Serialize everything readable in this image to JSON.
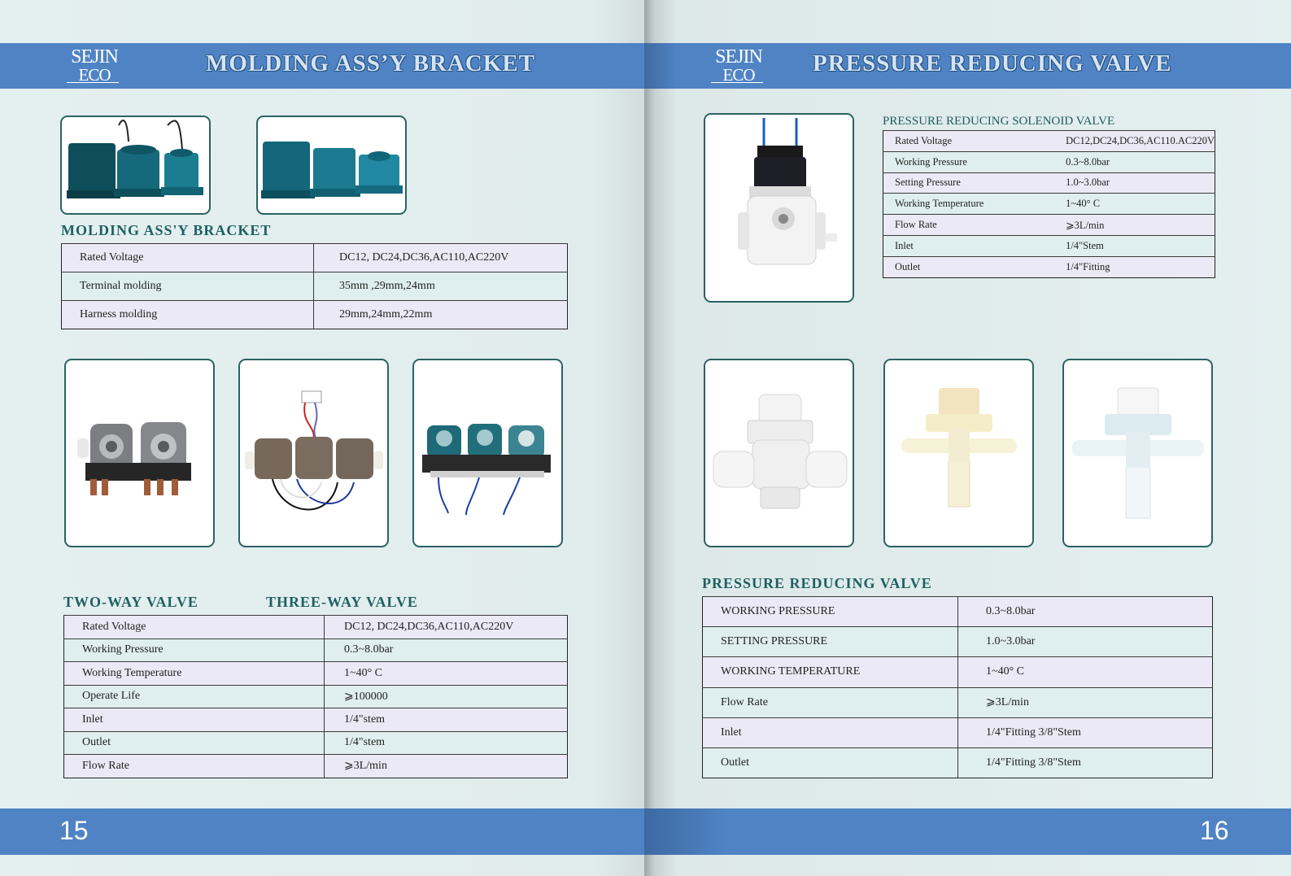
{
  "left_page": {
    "logo": {
      "line1": "SEJIN",
      "line2": "ECO"
    },
    "banner_title": "MOLDING ASS’Y BRACKET",
    "section_title": "MOLDING ASS'Y BRACKET",
    "bracket_specs": [
      {
        "label": "Rated Voltage",
        "value": "DC12,  DC24,DC36,AC110,AC220V"
      },
      {
        "label": "Terminal molding",
        "value": "35mm ,29mm,24mm"
      },
      {
        "label": "Harness molding",
        "value": "29mm,24mm,22mm"
      }
    ],
    "two_way_title": "TWO-WAY VALVE",
    "three_way_title": "THREE-WAY VALVE",
    "valve_specs": [
      {
        "label": "Rated Voltage",
        "value": "DC12,  DC24,DC36,AC110,AC220V"
      },
      {
        "label": "Working Pressure",
        "value": "0.3~8.0bar"
      },
      {
        "label": "Working Temperature",
        "value": "1~40° C"
      },
      {
        "label": "Operate Life",
        "value": "⩾100000"
      },
      {
        "label": "Inlet",
        "value": "1/4\"stem"
      },
      {
        "label": "Outlet",
        "value": "1/4\"stem"
      },
      {
        "label": "Flow Rate",
        "value": "⩾3L/min"
      }
    ],
    "page_number": "15"
  },
  "right_page": {
    "logo": {
      "line1": "SEJIN",
      "line2": "ECO"
    },
    "banner_title": "PRESSURE REDUCING  VALVE",
    "solenoid_title": "PRESSURE REDUCING SOLENOID VALVE",
    "solenoid_specs": [
      {
        "label": "Rated Voltage",
        "value": "DC12,DC24,DC36,AC110.AC220V"
      },
      {
        "label": "Working Pressure",
        "value": "0.3~8.0bar"
      },
      {
        "label": "Setting Pressure",
        "value": "1.0~3.0bar"
      },
      {
        "label": "Working Temperature",
        "value": "1~40° C"
      },
      {
        "label": "Flow Rate",
        "value": "⩾3L/min"
      },
      {
        "label": "Inlet",
        "value": "1/4\"Stem"
      },
      {
        "label": "Outlet",
        "value": "1/4\"Fitting"
      }
    ],
    "reducing_title": "PRESSURE REDUCING  VALVE",
    "reducing_specs": [
      {
        "label": "WORKING PRESSURE",
        "value": "0.3~8.0bar"
      },
      {
        "label": "SETTING PRESSURE",
        "value": "1.0~3.0bar"
      },
      {
        "label": "WORKING TEMPERATURE",
        "value": "1~40° C"
      },
      {
        "label": "Flow Rate",
        "value": "⩾3L/min"
      },
      {
        "label": "Inlet",
        "value": "1/4\"Fitting  3/8\"Stem"
      },
      {
        "label": "Outlet",
        "value": "1/4\"Fitting  3/8\"Stem"
      }
    ],
    "page_number": "16"
  }
}
